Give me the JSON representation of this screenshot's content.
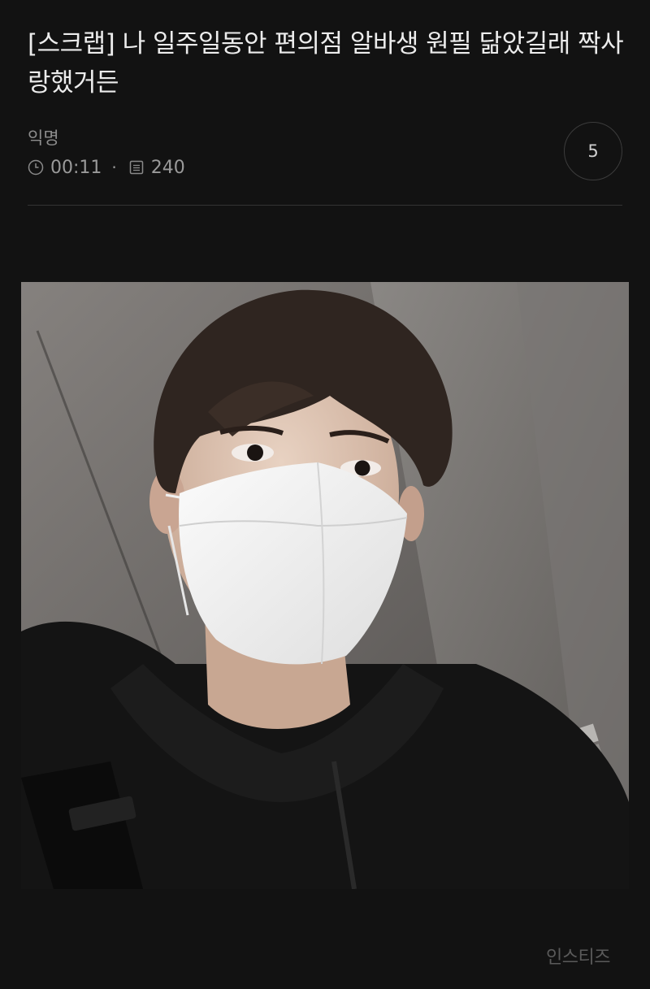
{
  "post": {
    "title": "[스크랩] 나 일주일동안 편의점 알바생 원필 닮았길래 짝사랑했거든",
    "author": "익명",
    "time": "00:11",
    "separator": "·",
    "views": "240",
    "comment_count": "5"
  },
  "icons": {
    "time": "clock-icon",
    "views": "document-list-icon"
  },
  "media": {
    "watermark": "인스티즈"
  },
  "colors": {
    "background": "#121212",
    "title_text": "#ececec",
    "meta_text": "#9a9a9a",
    "divider": "#333333"
  }
}
